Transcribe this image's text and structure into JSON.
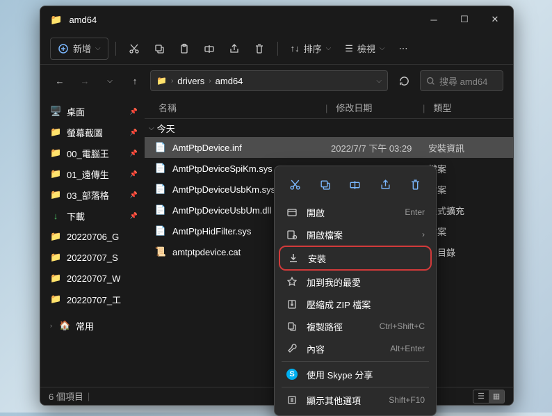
{
  "title": "amd64",
  "toolbar": {
    "new": "新增",
    "sort": "排序",
    "view": "檢視"
  },
  "breadcrumb": {
    "p1": "drivers",
    "p2": "amd64"
  },
  "search_placeholder": "搜尋 amd64",
  "sidebar": [
    {
      "label": "桌面",
      "icon": "🖥️",
      "pin": true,
      "color": "#5ab7ff"
    },
    {
      "label": "螢幕截圖",
      "icon": "📁",
      "pin": true
    },
    {
      "label": "00_電腦王",
      "icon": "📁",
      "pin": true
    },
    {
      "label": "01_遠傳生",
      "icon": "📁",
      "pin": true
    },
    {
      "label": "03_部落格",
      "icon": "📁",
      "pin": true
    },
    {
      "label": "下載",
      "icon": "↓",
      "pin": true,
      "color": "#4fc968"
    },
    {
      "label": "20220706_G",
      "icon": "📁"
    },
    {
      "label": "20220707_S",
      "icon": "📁"
    },
    {
      "label": "20220707_W",
      "icon": "📁"
    },
    {
      "label": "20220707_工",
      "icon": "📁"
    }
  ],
  "sidebar_freq": "常用",
  "columns": {
    "name": "名稱",
    "date": "修改日期",
    "type": "類型"
  },
  "group": "今天",
  "files": [
    {
      "name": "AmtPtpDevice.inf",
      "date": "2022/7/7 下午 03:29",
      "type": "安裝資訊",
      "sel": true,
      "ico": "📄"
    },
    {
      "name": "AmtPtpDeviceSpiKm.sys",
      "date": "",
      "type": "檔案",
      "ico": "📄"
    },
    {
      "name": "AmtPtpDeviceUsbKm.sys",
      "date": "",
      "type": "檔案",
      "ico": "📄"
    },
    {
      "name": "AmtPtpDeviceUsbUm.dll",
      "date": "",
      "type": "程式擴充",
      "ico": "📄"
    },
    {
      "name": "AmtPtpHidFilter.sys",
      "date": "",
      "type": "檔案",
      "ico": "📄"
    },
    {
      "name": "amtptpdevice.cat",
      "date": "",
      "type": "性目錄",
      "ico": "📜"
    }
  ],
  "status": "6 個項目",
  "ctx": {
    "open": "開啟",
    "open_sc": "Enter",
    "openwith": "開啟檔案",
    "install": "安裝",
    "fav": "加到我的最愛",
    "zip": "壓縮成 ZIP 檔案",
    "copy": "複製路徑",
    "copy_sc": "Ctrl+Shift+C",
    "props": "內容",
    "props_sc": "Alt+Enter",
    "skype": "使用 Skype 分享",
    "more": "顯示其他選項",
    "more_sc": "Shift+F10"
  }
}
